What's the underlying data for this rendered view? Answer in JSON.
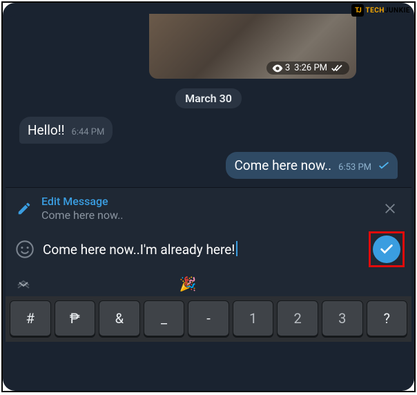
{
  "watermark": {
    "logo": "TJ",
    "text1": "TECH",
    "text2": "JUNKIE"
  },
  "photo": {
    "views": "3",
    "time": "3:26 PM"
  },
  "date_separator": "March 30",
  "msg_in": {
    "text": "Hello!!",
    "time": "6:44 PM"
  },
  "msg_out": {
    "text": "Come here now..",
    "time": "6:53 PM"
  },
  "edit_panel": {
    "title": "Edit Message",
    "original": "Come here now.."
  },
  "input": {
    "value": "Come here now..I'm already here!"
  },
  "suggest": {
    "emoji": "🎉"
  },
  "keyboard": {
    "keys": [
      "#",
      "₱",
      "&",
      "_",
      "-",
      "1",
      "2",
      "3",
      "?"
    ]
  }
}
